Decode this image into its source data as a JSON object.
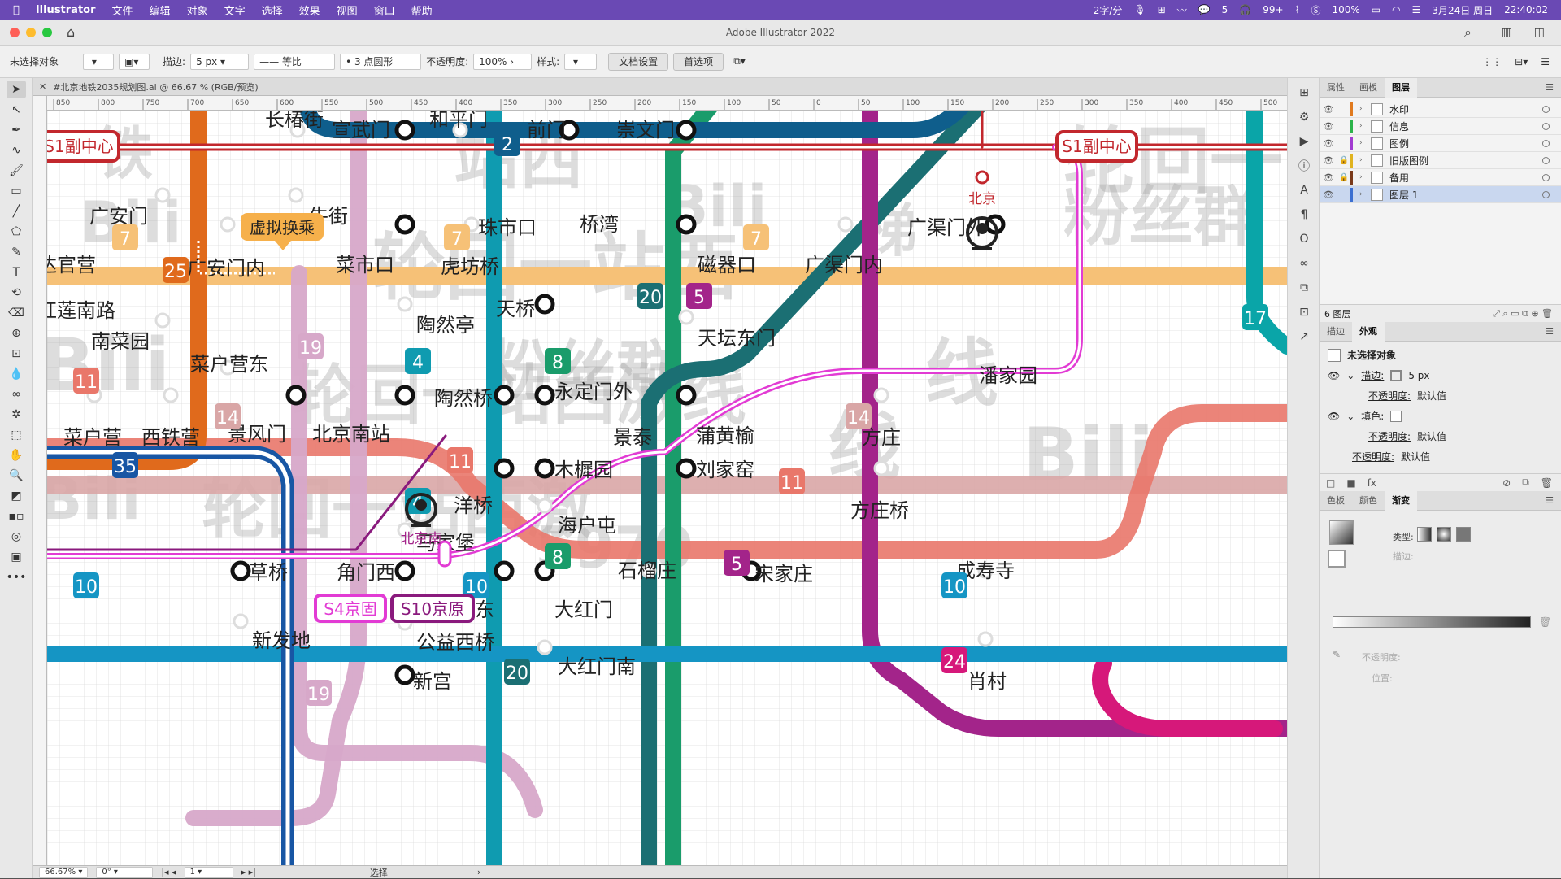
{
  "menubar": {
    "apple": "",
    "items": [
      "Illustrator",
      "文件",
      "编辑",
      "对象",
      "文字",
      "选择",
      "效果",
      "视图",
      "窗口",
      "帮助"
    ],
    "status": [
      "2字/分",
      "5",
      "99+",
      "100%",
      "3月24日 周日",
      "22:40:02"
    ]
  },
  "titlebar": {
    "title": "Adobe Illustrator 2022"
  },
  "control": {
    "selection": "未选择对象",
    "stroke_label": "描边:",
    "stroke_value": "5 px",
    "profile": "等比",
    "brush": "3 点圆形",
    "opacity_label": "不透明度:",
    "opacity_value": "100%",
    "style_label": "样式:",
    "doc_setup": "文档设置",
    "prefs": "首选项"
  },
  "doc": {
    "tab": "#北京地铁2035规划图.ai @ 66.67 % (RGB/预览)"
  },
  "status": {
    "zoom": "66.67%",
    "angle": "0°",
    "artboard": "1",
    "tool": "选择"
  },
  "ruler": {
    "ticks": [
      "850",
      "800",
      "750",
      "700",
      "650",
      "600",
      "550",
      "500",
      "450",
      "400",
      "350",
      "300",
      "250",
      "200",
      "150",
      "100",
      "50",
      "0",
      "50",
      "100",
      "150",
      "200",
      "250",
      "300",
      "350",
      "400",
      "450",
      "500"
    ]
  },
  "colors": {
    "line1": "#c2272d",
    "line2": "#0f5e8c",
    "line4": "#0f9bb0",
    "line5": "#a3248a",
    "line7": "#f6c177",
    "line8": "#1a9c6b",
    "line10": "#1595c4",
    "line11": "#e9776a",
    "line14": "#d9a6a6",
    "line17": "#0aa5a8",
    "line19": "#d7a8c9",
    "line20": "#1b6f73",
    "line24": "#d6187a",
    "line25": "#e06a1c",
    "line35": "#1856a4",
    "lineS1": "#c2272d",
    "lineS4": "#e23bd4",
    "accent": "#6a49b4"
  },
  "map": {
    "badges": {
      "s1_left": "S1副中心",
      "s1_right": "S1副中心",
      "s4": "S4京固",
      "s10": "S10京原",
      "transfer": "虚拟换乘"
    },
    "rail": {
      "beijing": "北京",
      "beijingnan": "北京南"
    },
    "line_labels": [
      "2",
      "7",
      "7",
      "7",
      "25",
      "20",
      "5",
      "17",
      "19",
      "4",
      "4",
      "8",
      "8",
      "11",
      "11",
      "11",
      "14",
      "14",
      "35",
      "10",
      "10",
      "10",
      "5",
      "20",
      "24",
      "19"
    ],
    "stations": [
      "长椿街",
      "宣武门",
      "和平门",
      "前门",
      "崇文门",
      "广安门",
      "牛街",
      "菜市口",
      "珠市口",
      "桥湾",
      "广渠门外",
      "达官营",
      "广安门内",
      "虎坊桥",
      "磁器口",
      "广渠门内",
      "红莲南路",
      "陶然亭",
      "天桥",
      "南菜园",
      "天坛东门",
      "菜户营东",
      "陶然桥",
      "永定门外",
      "潘家园",
      "菜户营",
      "西铁营",
      "景风门",
      "北京南站",
      "景泰",
      "蒲黄榆",
      "方庄",
      "木樨园",
      "刘家窑",
      "洋桥",
      "海户屯",
      "方庄桥",
      "马家堡",
      "草桥",
      "角门西",
      "石榴庄",
      "宋家庄",
      "成寿寺",
      "角门东",
      "大红门",
      "新发地",
      "公益西桥",
      "大红门南",
      "肖村",
      "新宫"
    ],
    "watermarks": [
      "铁",
      "站西",
      "轮回一",
      "Bili",
      "Bili",
      "梯",
      "轮回一站西",
      "粉丝群",
      "Bili",
      "粉丝群",
      "线",
      "轮回一站西激线",
      "Bili",
      "线",
      "Bili",
      "轮回一站西激",
      "5970"
    ]
  },
  "panel": {
    "tabs": [
      "属性",
      "画板",
      "图层"
    ],
    "layers": [
      {
        "name": "水印",
        "color": "#e07a1f",
        "locked": false
      },
      {
        "name": "信息",
        "color": "#2bb34a",
        "locked": false
      },
      {
        "name": "图例",
        "color": "#a23bd1",
        "locked": false
      },
      {
        "name": "旧版图例",
        "color": "#e0b31f",
        "locked": true
      },
      {
        "name": "备用",
        "color": "#7a3a1a",
        "locked": true
      },
      {
        "name": "图层 1",
        "color": "#3b6fd1",
        "locked": false
      }
    ],
    "layer_count": "6 图层",
    "tabs2": [
      "描边",
      "外观"
    ],
    "appearance": {
      "title": "未选择对象",
      "stroke": "描边:",
      "stroke_val": "5 px",
      "opacity": "不透明度:",
      "default": "默认值",
      "fill": "填色:",
      "opacity2": "不透明度:",
      "default2": "默认值",
      "opacity3": "不透明度:",
      "default3": "默认值"
    },
    "tabs3": [
      "色板",
      "颜色",
      "渐变"
    ],
    "gradient": {
      "type_label": "类型:",
      "stroke_label": "描边:",
      "opacity_label": "不透明度:",
      "position_label": "位置:"
    }
  }
}
